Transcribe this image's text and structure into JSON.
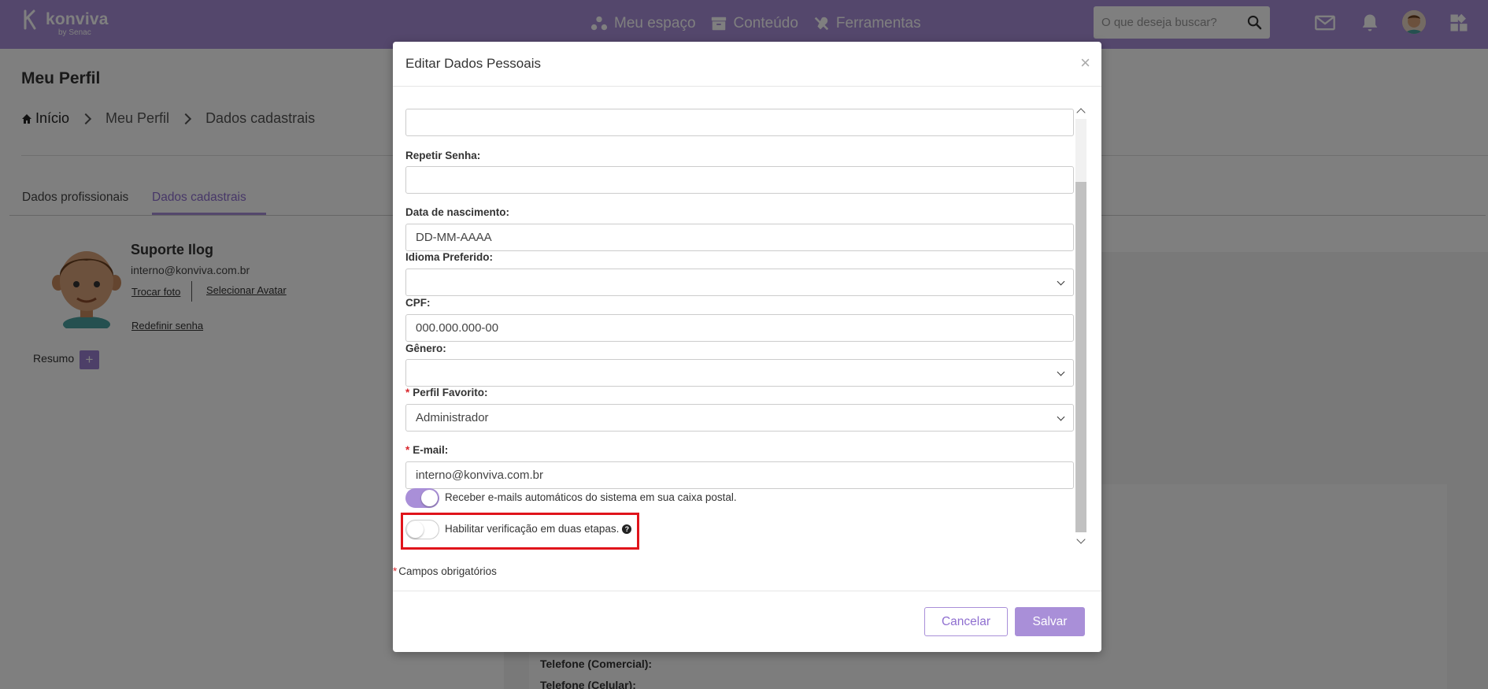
{
  "topbar": {
    "logo_text": "konviva",
    "logo_sub": "by Senac",
    "nav": [
      {
        "label": "Meu espaço",
        "icon": "users-icon"
      },
      {
        "label": "Conteúdo",
        "icon": "archive-icon"
      },
      {
        "label": "Ferramentas",
        "icon": "tools-icon"
      }
    ],
    "search_placeholder": "O que deseja buscar?",
    "icons": [
      "search-icon",
      "mail-icon",
      "bell-icon",
      "avatar",
      "apps-grid-icon"
    ],
    "accent_color": "#a98fd8"
  },
  "page": {
    "title": "Meu Perfil",
    "breadcrumb": [
      "Início",
      "Meu Perfil",
      "Dados cadastrais"
    ],
    "tabs": [
      "Dados profissionais",
      "Dados cadastrais"
    ],
    "active_tab": "Dados cadastrais",
    "profile": {
      "name": "Suporte Ilog",
      "email": "interno@konviva.com.br",
      "change_photo": "Trocar foto",
      "select_avatar": "Selecionar Avatar",
      "reset_password": "Redefinir senha"
    },
    "summary_label": "Resumo",
    "summary_add": "+",
    "background_fields": [
      "Telefone (Comercial):",
      "Telefone (Celular):"
    ]
  },
  "modal": {
    "title": "Editar Dados Pessoais",
    "close": "×",
    "fields": {
      "repeat_password": {
        "label": "Repetir Senha:",
        "value": ""
      },
      "birth_date": {
        "label": "Data de nascimento:",
        "placeholder": "DD-MM-AAAA"
      },
      "language": {
        "label": "Idioma Preferido:",
        "value": ""
      },
      "cpf": {
        "label": "CPF:",
        "placeholder": "000.000.000-00"
      },
      "gender": {
        "label": "Gênero:",
        "value": ""
      },
      "favorite_profile": {
        "label": "Perfil Favorito:",
        "value": "Administrador",
        "required": true
      },
      "email": {
        "label": "E-mail:",
        "value": "interno@konviva.com.br",
        "required": true
      }
    },
    "toggles": [
      {
        "label": "Receber e-mails automáticos do sistema em sua caixa postal.",
        "on": true
      },
      {
        "label": "Habilitar verificação em duas etapas.",
        "on": false
      }
    ],
    "help_symbol": "?",
    "required_mark": "*",
    "required_note": "Campos obrigatórios",
    "buttons": {
      "cancel": "Cancelar",
      "save": "Salvar"
    }
  }
}
